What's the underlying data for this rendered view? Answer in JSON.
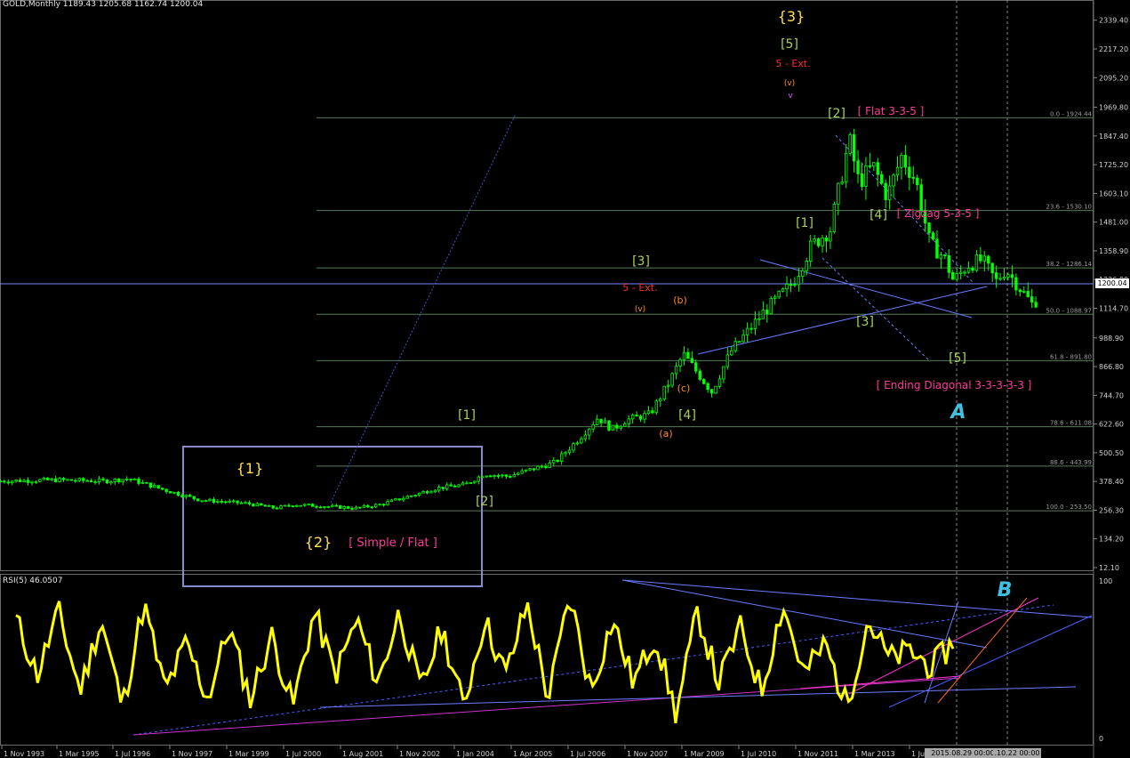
{
  "header": {
    "symbol_label": "GOLD,Monthly",
    "ohlc": "1189.43 1205.68 1162.74 1200.04"
  },
  "rsi_header": {
    "label": "RSI(5)",
    "value": "46.0507"
  },
  "last_price_box": "1200.04",
  "vertical_date_boxes": [
    "2015.08.29 00:00",
    ".10.22 00:00"
  ],
  "colors": {
    "background": "#000000",
    "candle": "#00ff00",
    "rsi_line": "#ffff00",
    "trendline": "#5a6bff",
    "fib_line": "#5a7a5a",
    "wave_yellow": "#ffe14a",
    "wave_green": "#a8d060",
    "wave_red": "#ff2a2a",
    "wave_orange": "#ff8a2a",
    "wave_cyan": "#40c0e0",
    "wave_magenta": "#ff3b9a",
    "wave_purple": "#cc66ff"
  },
  "chart_data": [
    {
      "type": "candlestick",
      "title": "GOLD,Monthly",
      "y_ticks": [
        "2339.40",
        "2217.20",
        "2095.20",
        "1969.80",
        "1847.40",
        "1725.20",
        "1603.10",
        "1481.00",
        "1358.90",
        "1236.80",
        "1200.04",
        "1114.70",
        "988.90",
        "866.80",
        "744.70",
        "622.60",
        "500.50",
        "378.40",
        "256.30",
        "134.20",
        "12.10"
      ],
      "x_ticks": [
        "1 Nov 1993",
        "1 Mar 1995",
        "1 Jul 1996",
        "1 Nov 1997",
        "1 Mar 1999",
        "1 Jul 2000",
        "1 Aug 2001",
        "1 Nov 2002",
        "1 Jan 2004",
        "1 Apr 2005",
        "1 Jul 2006",
        "1 Nov 2007",
        "1 Mar 2009",
        "1 Jul 2010",
        "1 Nov 2011",
        "1 Mar 2013",
        "1 Ju"
      ],
      "ylim": [
        12.1,
        2380
      ],
      "close_path": [
        [
          1993.8,
          380
        ],
        [
          1995,
          385
        ],
        [
          1996,
          380
        ],
        [
          1996.5,
          390
        ],
        [
          1997.3,
          340
        ],
        [
          1998,
          300
        ],
        [
          1999,
          285
        ],
        [
          1999.6,
          265
        ],
        [
          2000,
          280
        ],
        [
          2000.9,
          270
        ],
        [
          2001.3,
          265
        ],
        [
          2001.8,
          280
        ],
        [
          2002.5,
          320
        ],
        [
          2003,
          350
        ],
        [
          2003.6,
          365
        ],
        [
          2004,
          410
        ],
        [
          2004.5,
          400
        ],
        [
          2005,
          430
        ],
        [
          2005.5,
          460
        ],
        [
          2006,
          560
        ],
        [
          2006.4,
          650
        ],
        [
          2006.7,
          600
        ],
        [
          2007,
          640
        ],
        [
          2007.5,
          665
        ],
        [
          2007.9,
          800
        ],
        [
          2008.2,
          920
        ],
        [
          2008.8,
          760
        ],
        [
          2009.2,
          930
        ],
        [
          2009.9,
          1100
        ],
        [
          2010.5,
          1220
        ],
        [
          2010.9,
          1380
        ],
        [
          2011.3,
          1450
        ],
        [
          2011.7,
          1830
        ],
        [
          2011.9,
          1650
        ],
        [
          2012.2,
          1720
        ],
        [
          2012.5,
          1590
        ],
        [
          2012.8,
          1760
        ],
        [
          2013.1,
          1660
        ],
        [
          2013.4,
          1390
        ],
        [
          2013.7,
          1330
        ],
        [
          2013.9,
          1230
        ],
        [
          2014.2,
          1300
        ],
        [
          2014.5,
          1320
        ],
        [
          2014.8,
          1230
        ],
        [
          2015.0,
          1280
        ],
        [
          2015.3,
          1200
        ],
        [
          2015.6,
          1120
        ],
        [
          2015.7,
          1200
        ]
      ],
      "fibonacci_levels": [
        {
          "label": "0.0 - 1924.44",
          "price": 1924.44
        },
        {
          "label": "23.6 - 1530.10",
          "price": 1530.1
        },
        {
          "label": "38.2 - 1286.14",
          "price": 1286.14
        },
        {
          "label": "50.0 - 1088.97",
          "price": 1088.97
        },
        {
          "label": "61.8 - 891.80",
          "price": 891.8
        },
        {
          "label": "78.6 - 611.08",
          "price": 611.08
        },
        {
          "label": "88.6 - 443.99",
          "price": 443.99
        },
        {
          "label": "100.0 - 253.50",
          "price": 253.5
        }
      ],
      "annotations": [
        {
          "text": "{3}",
          "color": "wave_yellow"
        },
        {
          "text": "[5]",
          "color": "wave_green"
        },
        {
          "text": "5 - Ext.",
          "color": "wave_red"
        },
        {
          "text": "(v)",
          "color": "wave_orange"
        },
        {
          "text": "v",
          "color": "wave_purple"
        },
        {
          "text": "[2]",
          "color": "wave_green"
        },
        {
          "text": "[ Flat 3-3-5 ]",
          "color": "wave_magenta"
        },
        {
          "text": "[4]",
          "color": "wave_green"
        },
        {
          "text": "[ Zigzag 5-3-5 ]",
          "color": "wave_magenta"
        },
        {
          "text": "[1]",
          "color": "wave_green"
        },
        {
          "text": "[3]",
          "color": "wave_green"
        },
        {
          "text": "[5]",
          "color": "wave_green"
        },
        {
          "text": "[ Ending Diagonal 3-3-3-3-3 ]",
          "color": "wave_magenta"
        },
        {
          "text": "A",
          "color": "wave_cyan"
        },
        {
          "text": "[3]",
          "color": "wave_green"
        },
        {
          "text": "5 - Ext.",
          "color": "wave_red"
        },
        {
          "text": "(v)",
          "color": "wave_orange"
        },
        {
          "text": "(b)",
          "color": "wave_orange"
        },
        {
          "text": "(c)",
          "color": "wave_orange"
        },
        {
          "text": "(a)",
          "color": "wave_orange"
        },
        {
          "text": "[4]",
          "color": "wave_green"
        },
        {
          "text": "[1]",
          "color": "wave_green"
        },
        {
          "text": "[2]",
          "color": "wave_green"
        },
        {
          "text": "{1}",
          "color": "wave_yellow"
        },
        {
          "text": "{2}",
          "color": "wave_yellow"
        },
        {
          "text": "[ Simple / Flat ]",
          "color": "wave_magenta"
        }
      ]
    },
    {
      "type": "line",
      "title": "RSI(5) 46.0507",
      "series": [
        {
          "name": "RSI(5)",
          "values": [
            75,
            40,
            80,
            30,
            75,
            20,
            85,
            30,
            60,
            25,
            70,
            25,
            65,
            20,
            80,
            40,
            75,
            35,
            80,
            30,
            70,
            20,
            75,
            40,
            85,
            25,
            90,
            30,
            75,
            35,
            65,
            15,
            80,
            35,
            70,
            30,
            85,
            40,
            60,
            20,
            75,
            50,
            55,
            45,
            60
          ]
        }
      ],
      "ylim": [
        0,
        100
      ],
      "y_ticks": [
        "100",
        "0"
      ],
      "annotations": [
        {
          "text": "B",
          "color": "wave_cyan"
        }
      ]
    }
  ]
}
